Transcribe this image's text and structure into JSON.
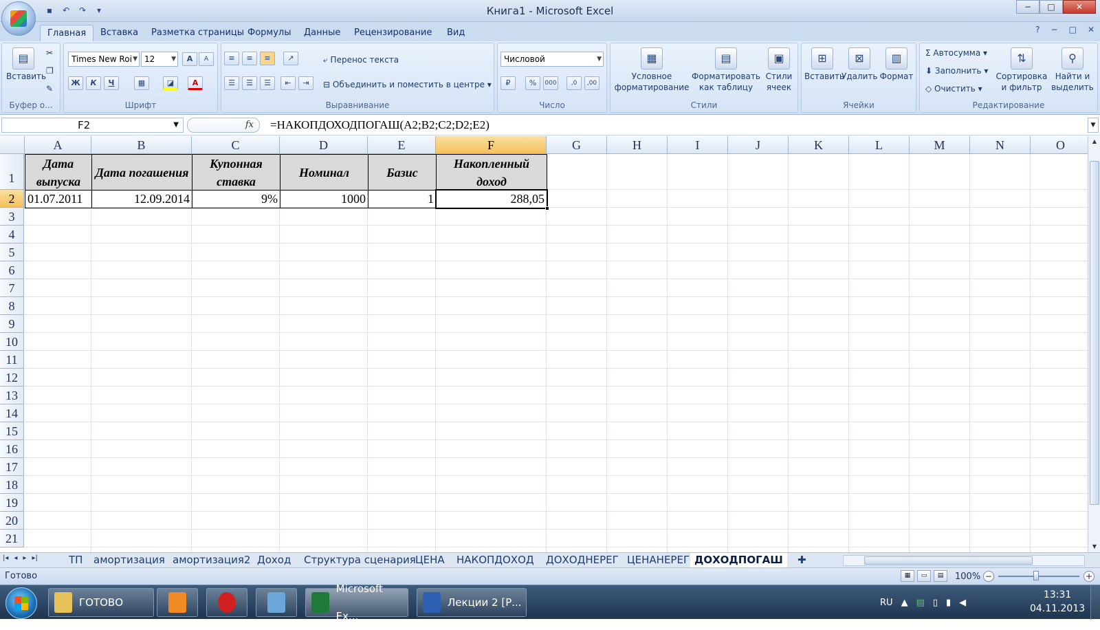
{
  "window": {
    "title": "Книга1 - Microsoft Excel",
    "minimize_label": "−",
    "maximize_label": "□",
    "close_label": "✕"
  },
  "qat": {
    "save_icon": "save-icon",
    "undo_icon": "undo-icon",
    "redo_icon": "redo-icon",
    "save_glyph": "▪",
    "undo_glyph": "↶",
    "redo_glyph": "↷",
    "customize_glyph": "▾"
  },
  "ribbon_tabs": [
    "Главная",
    "Вставка",
    "Разметка страницы",
    "Формулы",
    "Данные",
    "Рецензирование",
    "Вид"
  ],
  "help_icons": [
    "?",
    "−",
    "□",
    "✕"
  ],
  "ribbon": {
    "clipboard": {
      "paste": "Вставить",
      "title": "Буфер о..."
    },
    "font": {
      "family": "Times New Roi",
      "size": "12",
      "grow": "A",
      "shrink": "A",
      "bold": "Ж",
      "italic": "К",
      "underline": "Ч",
      "borders": "▦",
      "fill": "◪",
      "color": "A",
      "title": "Шрифт"
    },
    "alignment": {
      "wrap": "Перенос текста",
      "merge": "Объединить и поместить в центре",
      "title": "Выравнивание"
    },
    "number": {
      "format": "Числовой",
      "currency": "₽",
      "percent": "%",
      "thousands": "000",
      "inc": ",0",
      "dec": ",00",
      "title": "Число"
    },
    "styles": {
      "conditional": "Условное форматирование",
      "table": "Форматировать как таблицу",
      "cell": "Стили ячеек",
      "title": "Стили"
    },
    "cells": {
      "insert": "Вставить",
      "delete": "Удалить",
      "format": "Формат",
      "title": "Ячейки"
    },
    "editing": {
      "autosum": "Автосумма",
      "fill": "Заполнить",
      "clear": "Очистить",
      "sort": "Сортировка и фильтр",
      "find": "Найти и выделить",
      "title": "Редактирование"
    }
  },
  "formula_bar": {
    "name_box": "F2",
    "fx": "fx",
    "formula": "=НАКОПДОХОДПОГАШ(A2;B2;C2;D2;E2)"
  },
  "grid": {
    "columns": [
      "A",
      "B",
      "C",
      "D",
      "E",
      "F",
      "G",
      "H",
      "I",
      "J",
      "K",
      "L",
      "M",
      "N",
      "O"
    ],
    "rows": [
      "1",
      "2",
      "3",
      "4",
      "5",
      "6",
      "7",
      "8",
      "9",
      "10",
      "11",
      "12",
      "13",
      "14",
      "15",
      "16",
      "17",
      "18",
      "19",
      "20",
      "21"
    ],
    "selected_cell": "F2",
    "header_row": [
      "Дата выпуска",
      "Дата погашения",
      "Купонная ставка",
      "Номинал",
      "Базис",
      "Накопленный доход"
    ],
    "data_row": [
      "01.07.2011",
      "12.09.2014",
      "9%",
      "1000",
      "1",
      "288,05"
    ]
  },
  "sheets": {
    "tabs": [
      "ТП",
      "амортизация",
      "амортизация2",
      "Доход",
      "Структура сценария",
      "ЦЕНА",
      "НАКОПДОХОД",
      "ДОХОДНЕРЕГ",
      "ЦЕНАНЕРЕГ",
      "ДОХОДПОГАШ"
    ],
    "active": "ДОХОДПОГАШ",
    "nav": [
      "|◂",
      "◂",
      "▸",
      "▸|"
    ]
  },
  "status": {
    "text": "Готово",
    "zoom": "100%",
    "zoom_minus": "−",
    "zoom_plus": "+"
  },
  "taskbar": {
    "items": [
      {
        "label": "ГОТОВО",
        "icon": "folder-icon",
        "color": "#e8c25a"
      },
      {
        "label": "",
        "icon": "media-player-icon",
        "color": "#f08a24"
      },
      {
        "label": "",
        "icon": "opera-icon",
        "color": "#d0201f"
      },
      {
        "label": "",
        "icon": "pictures-icon",
        "color": "#6aa6d8"
      },
      {
        "label": "Microsoft Ex...",
        "icon": "excel-icon",
        "color": "#1f7a3a"
      },
      {
        "label": "Лекции 2 [Р...",
        "icon": "word-icon",
        "color": "#2d5fb3"
      }
    ],
    "language": "RU",
    "time": "13:31",
    "date": "04.11.2013"
  },
  "colors": {
    "accent": "#2b579a",
    "selected_header": "#f5c15a",
    "header_fill": "#d9d9d9"
  }
}
